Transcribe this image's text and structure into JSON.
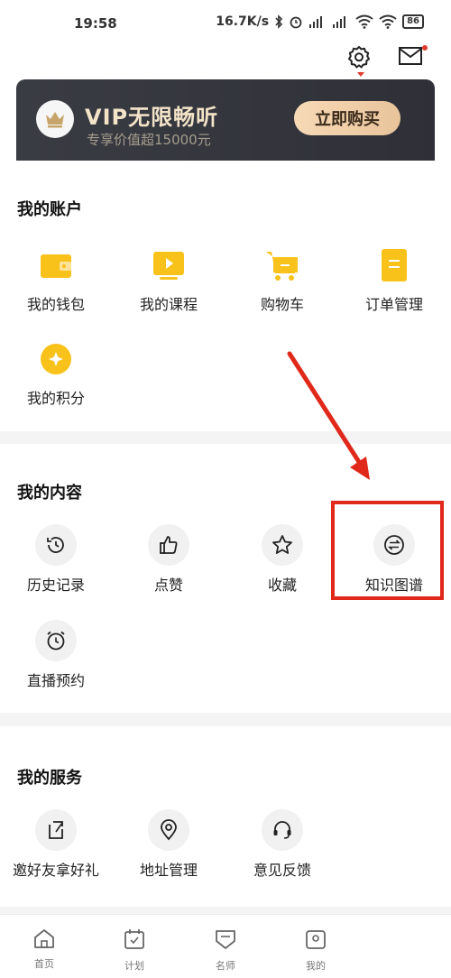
{
  "status_bar": {
    "time": "19:58",
    "speed": "16.7K/s",
    "battery": "86"
  },
  "header": {
    "settings_icon": "gear-icon",
    "mail_icon": "mail-icon"
  },
  "vip": {
    "title": "VIP无限畅听",
    "subtitle": "专享价值超15000元",
    "buy_label": "立即购买"
  },
  "account": {
    "title": "我的账户",
    "items": [
      {
        "label": "我的钱包",
        "icon": "wallet-icon"
      },
      {
        "label": "我的课程",
        "icon": "course-icon"
      },
      {
        "label": "购物车",
        "icon": "cart-icon"
      },
      {
        "label": "订单管理",
        "icon": "order-icon"
      },
      {
        "label": "我的积分",
        "icon": "points-icon"
      }
    ]
  },
  "content": {
    "title": "我的内容",
    "items": [
      {
        "label": "历史记录",
        "icon": "history-icon"
      },
      {
        "label": "点赞",
        "icon": "thumbs-up-icon"
      },
      {
        "label": "收藏",
        "icon": "star-icon"
      },
      {
        "label": "知识图谱",
        "icon": "exchange-icon"
      },
      {
        "label": "直播预约",
        "icon": "alarm-clock-icon"
      }
    ]
  },
  "service": {
    "title": "我的服务",
    "items": [
      {
        "label": "邀好友拿好礼",
        "icon": "invite-icon"
      },
      {
        "label": "地址管理",
        "icon": "location-icon"
      },
      {
        "label": "意见反馈",
        "icon": "feedback-icon"
      }
    ]
  },
  "bottom_nav": [
    {
      "label": "首页",
      "icon": "home-icon"
    },
    {
      "label": "计划",
      "icon": "plan-icon"
    },
    {
      "label": "名师",
      "icon": "teacher-icon"
    },
    {
      "label": "我的",
      "icon": "profile-icon"
    }
  ],
  "colors": {
    "accent_yellow": "#f8c21a",
    "vip_bg": "#33353c",
    "vip_gold": "#f3e4c8",
    "annotation_red": "#e0291b"
  }
}
